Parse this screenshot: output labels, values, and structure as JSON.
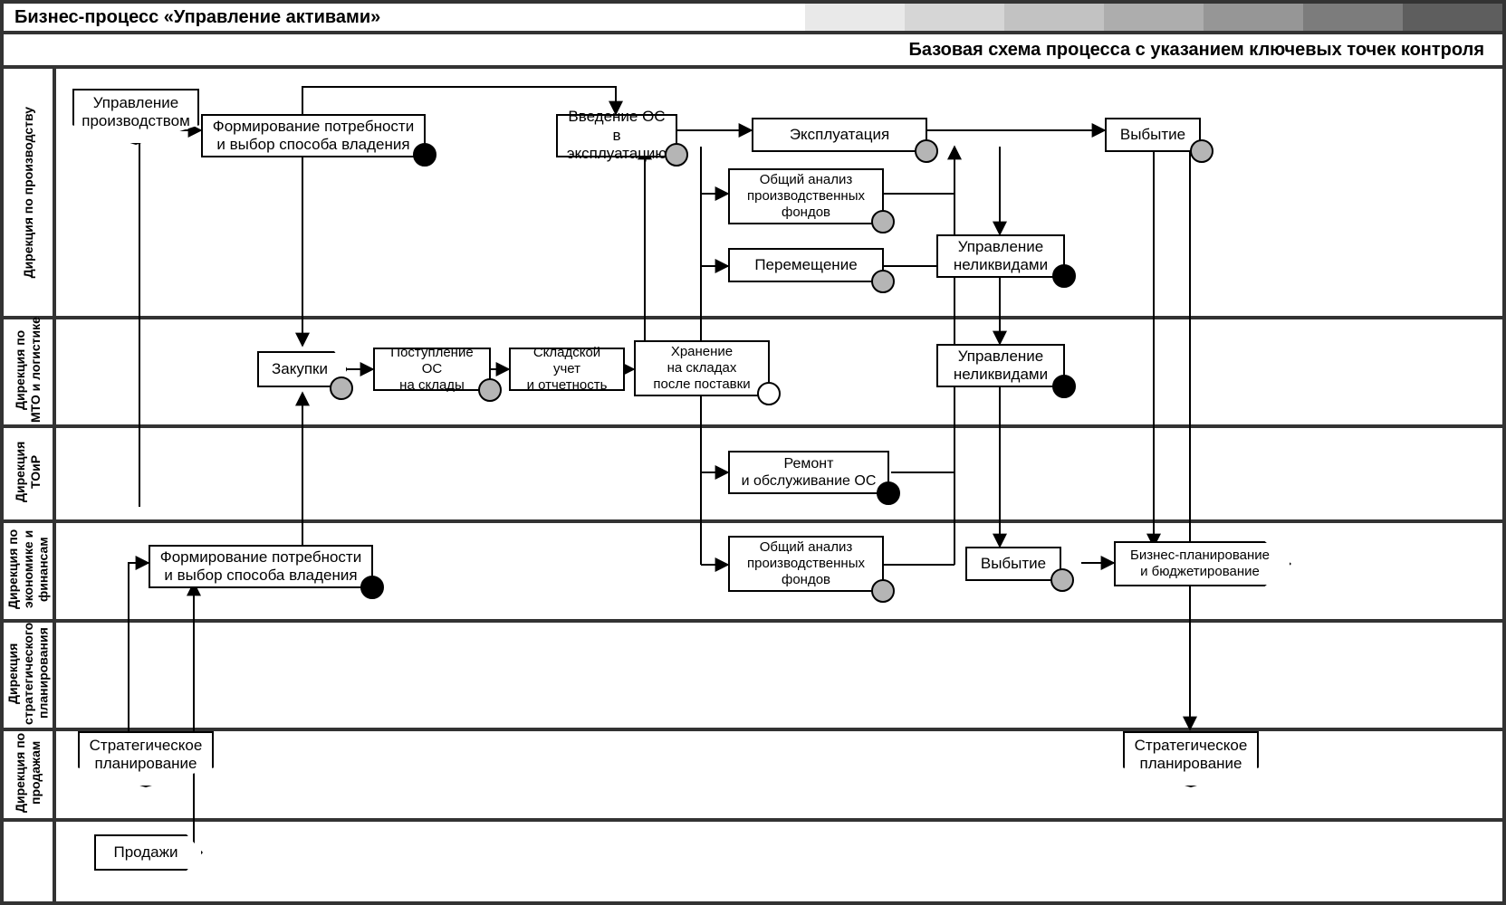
{
  "title": "Бизнес-процесс «Управление активами»",
  "subtitle": "Базовая схема процесса с указанием ключевых точек контроля",
  "lanes": {
    "l1": "Дирекция по производству",
    "l2": "Дирекция\nпо МТО и логистике",
    "l3": "Дирекция ТОиР",
    "l4": "Дирекция\nпо экономике\nи финансам",
    "l5": "Дирекция\nстратегического\nпланирования",
    "l6": "Дирекция\nпо продажам"
  },
  "nodes": {
    "upr_proizv": "Управление\nпроизводством",
    "form_potreb_1": "Формирование потребности\nи выбор способа владения",
    "vvedenie_os": "Введение ОС\nв эксплуатацию",
    "ekspluat": "Эксплуатация",
    "vybytie_1": "Выбытие",
    "obsh_analiz_1": "Общий анализ\nпроизводственных\nфондов",
    "peremesh": "Перемещение",
    "upr_nelikv_1": "Управление\nнеликвидами",
    "zakupki": "Закупки",
    "postup_os": "Поступление ОС\nна склады",
    "sklad_uchet": "Складской учет\nи отчетность",
    "hranenie": "Хранение\nна складах\nпосле поставки",
    "upr_nelikv_2": "Управление\nнеликвидами",
    "remont": "Ремонт\nи обслуживание ОС",
    "form_potreb_2": "Формирование потребности\nи выбор способа владения",
    "obsh_analiz_2": "Общий анализ\nпроизводственных\nфондов",
    "vybytie_2": "Выбытие",
    "biznes_plan": "Бизнес-планирование\nи бюджетирование",
    "strat_plan_1": "Стратегическое\nпланирование",
    "strat_plan_2": "Стратегическое\nпланирование",
    "prodazhi": "Продажи"
  }
}
